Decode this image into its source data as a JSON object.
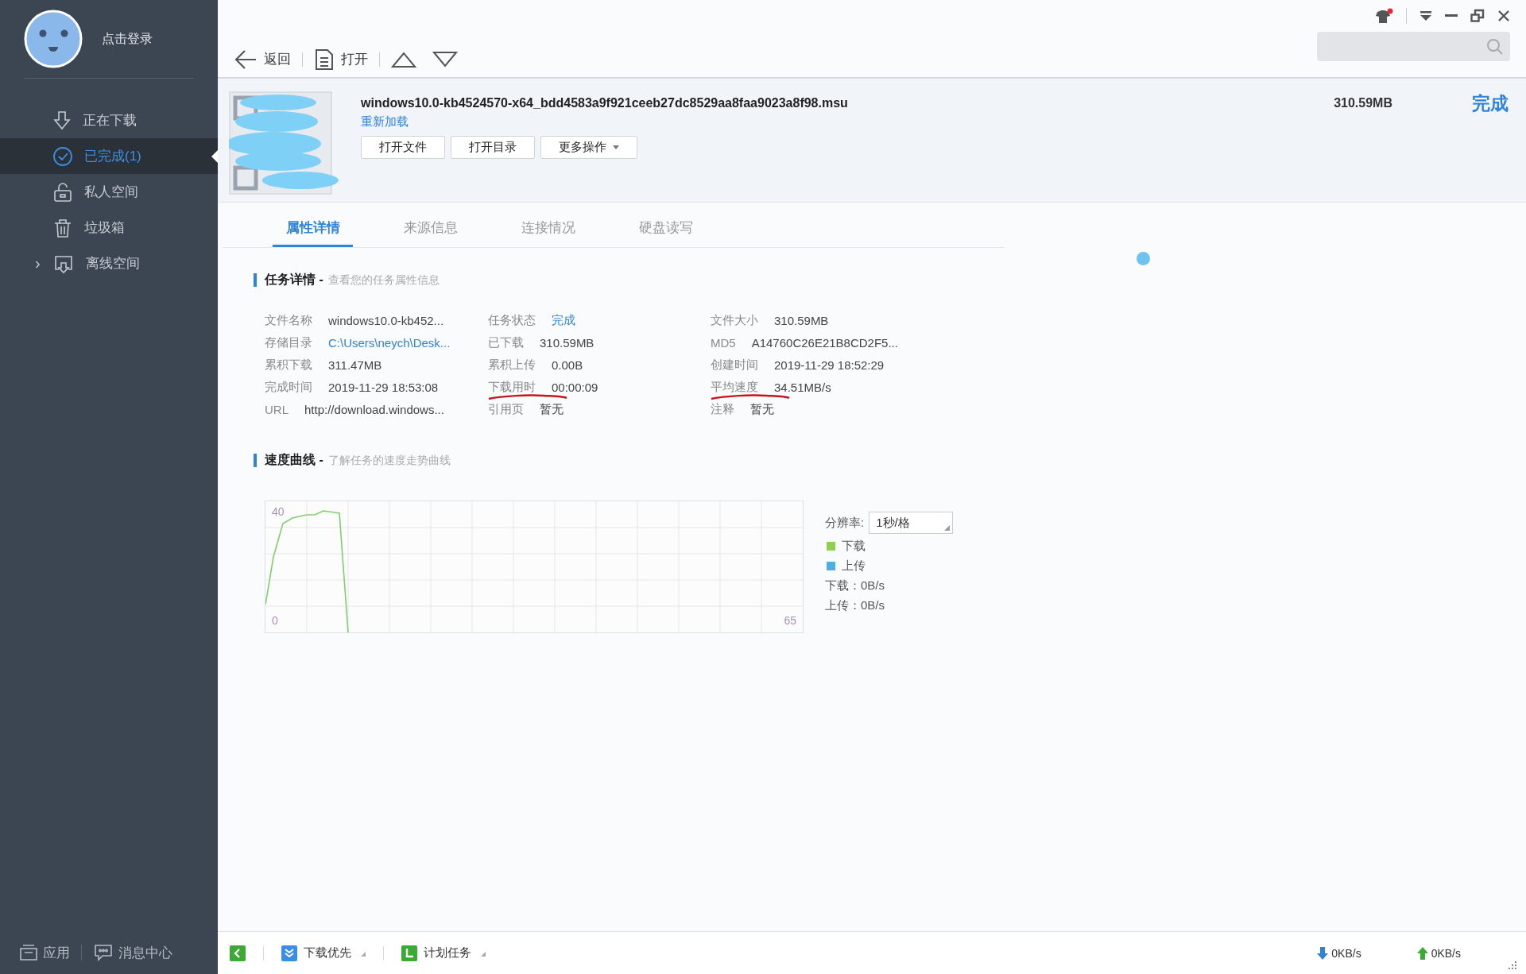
{
  "user": {
    "login_label": "点击登录"
  },
  "sidebar": {
    "items": [
      {
        "label": "正在下载",
        "kind": "item",
        "selected": false
      },
      {
        "label": "已完成(1)",
        "kind": "item",
        "selected": true
      },
      {
        "label": "私人空间",
        "kind": "item",
        "selected": false
      },
      {
        "label": "垃圾箱",
        "kind": "item",
        "selected": false
      },
      {
        "label": "离线空间",
        "kind": "group",
        "expander": "›",
        "selected": false
      }
    ],
    "footer": [
      {
        "label": "应用"
      },
      {
        "label": "消息中心"
      }
    ]
  },
  "toolbar": {
    "back": "返回",
    "open": "打开",
    "notification": true
  },
  "task": {
    "filename": "windows10.0-kb4524570-x64_bdd4583a9f921ceeb27dc8529aa8faa9023a8f98.msu",
    "reload": "重新加载",
    "size": "310.59MB",
    "status": "完成",
    "buttons": [
      {
        "label": "打开文件",
        "kind": "button"
      },
      {
        "label": "打开目录",
        "kind": "button"
      },
      {
        "label": "更多操作",
        "kind": "dropdown"
      }
    ]
  },
  "tabs": [
    {
      "label": "属性详情",
      "selected": true
    },
    {
      "label": "来源信息",
      "selected": false
    },
    {
      "label": "连接情况",
      "selected": false
    },
    {
      "label": "硬盘读写",
      "selected": false
    }
  ],
  "details": {
    "title": "任务详情 -",
    "subtitle": "查看您的任务属性信息",
    "columns": [
      [
        {
          "label": "文件名称",
          "value": "windows10.0-kb452...",
          "kind": "text",
          "marked": false
        },
        {
          "label": "存储目录",
          "value": "C:\\Users\\neych\\Desk...",
          "kind": "link",
          "marked": false
        },
        {
          "label": "累积下载",
          "value": "311.47MB",
          "kind": "text",
          "marked": false
        },
        {
          "label": "完成时间",
          "value": "2019-11-29 18:53:08",
          "kind": "text",
          "marked": false
        },
        {
          "label": "URL",
          "value": "http://download.windows...",
          "kind": "text",
          "marked": false
        }
      ],
      [
        {
          "label": "任务状态",
          "value": "完成",
          "kind": "link",
          "marked": false
        },
        {
          "label": "已下载",
          "value": "310.59MB",
          "kind": "text",
          "marked": false
        },
        {
          "label": "累积上传",
          "value": "0.00B",
          "kind": "text",
          "marked": false
        },
        {
          "label": "下载用时",
          "value": "00:00:09",
          "kind": "text",
          "marked": true
        },
        {
          "label": "引用页",
          "value": "暂无",
          "kind": "text",
          "marked": false
        }
      ],
      [
        {
          "label": "文件大小",
          "value": "310.59MB",
          "kind": "text",
          "marked": false
        },
        {
          "label": "MD5",
          "value": "A14760C26E21B8CD2F5...",
          "kind": "text",
          "marked": false
        },
        {
          "label": "创建时间",
          "value": "2019-11-29 18:52:29",
          "kind": "text",
          "marked": false
        },
        {
          "label": "平均速度",
          "value": "34.51MB/s",
          "kind": "text",
          "marked": true
        },
        {
          "label": "注释",
          "value": "暂无",
          "kind": "text",
          "marked": false
        }
      ]
    ]
  },
  "speed": {
    "title": "速度曲线 -",
    "subtitle": "了解任务的速度走势曲线",
    "resolution_label": "分辨率:",
    "resolution": "1秒/格",
    "legend": [
      {
        "label": "下载",
        "color": "#8fd14f"
      },
      {
        "label": "上传",
        "color": "#4aaee8"
      }
    ],
    "readings": [
      "下载：0B/s",
      "上传：0B/s"
    ],
    "graph_labels": [
      "40",
      "0",
      "65"
    ]
  },
  "status_bar": {
    "items": [
      {
        "label": "下载优先",
        "kind": "priority"
      },
      {
        "label": "计划任务",
        "kind": "schedule"
      }
    ],
    "download_speed": "0KB/s",
    "upload_speed": "0KB/s"
  }
}
